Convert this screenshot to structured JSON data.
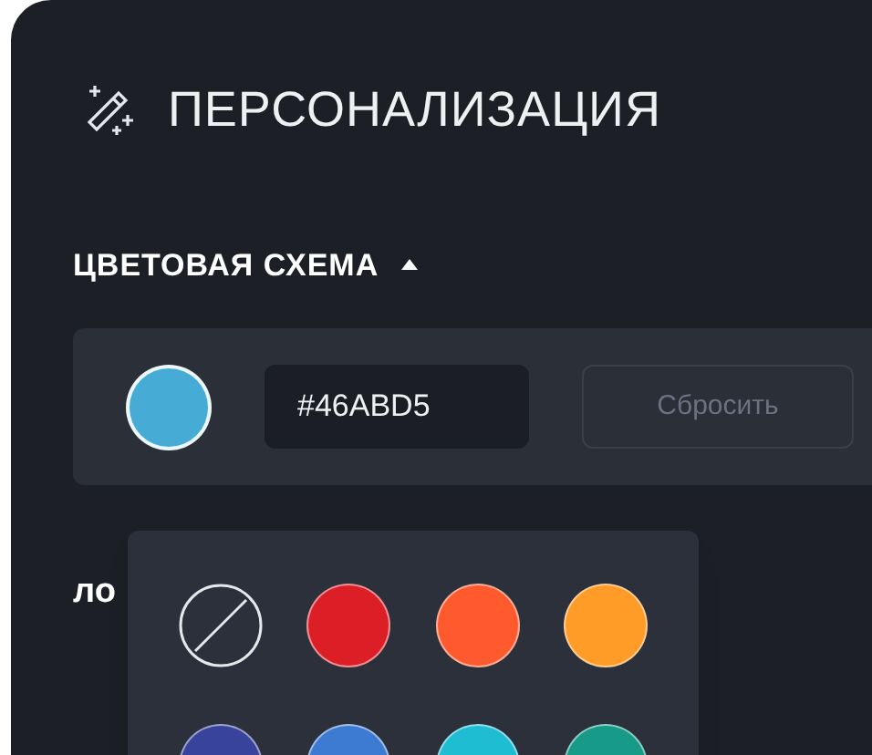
{
  "title": "ПЕРСОНАЛИЗАЦИЯ",
  "color_scheme": {
    "heading": "ЦВЕТОВАЯ СХЕМА",
    "expanded": true,
    "hex_value": "#46ABD5",
    "reset_button": {
      "label": "Сбросить",
      "disabled": true
    }
  },
  "next_section_heading": "ло",
  "palette": [
    {
      "kind": "none"
    },
    {
      "kind": "color",
      "color": "#dc1f26"
    },
    {
      "kind": "color",
      "color": "#fe5a2d"
    },
    {
      "kind": "color",
      "color": "#ff9b27"
    },
    {
      "kind": "color",
      "color": "#38439b"
    },
    {
      "kind": "color",
      "color": "#3d7ad2"
    },
    {
      "kind": "color",
      "color": "#1fbdd2"
    },
    {
      "kind": "color",
      "color": "#179a87"
    }
  ]
}
